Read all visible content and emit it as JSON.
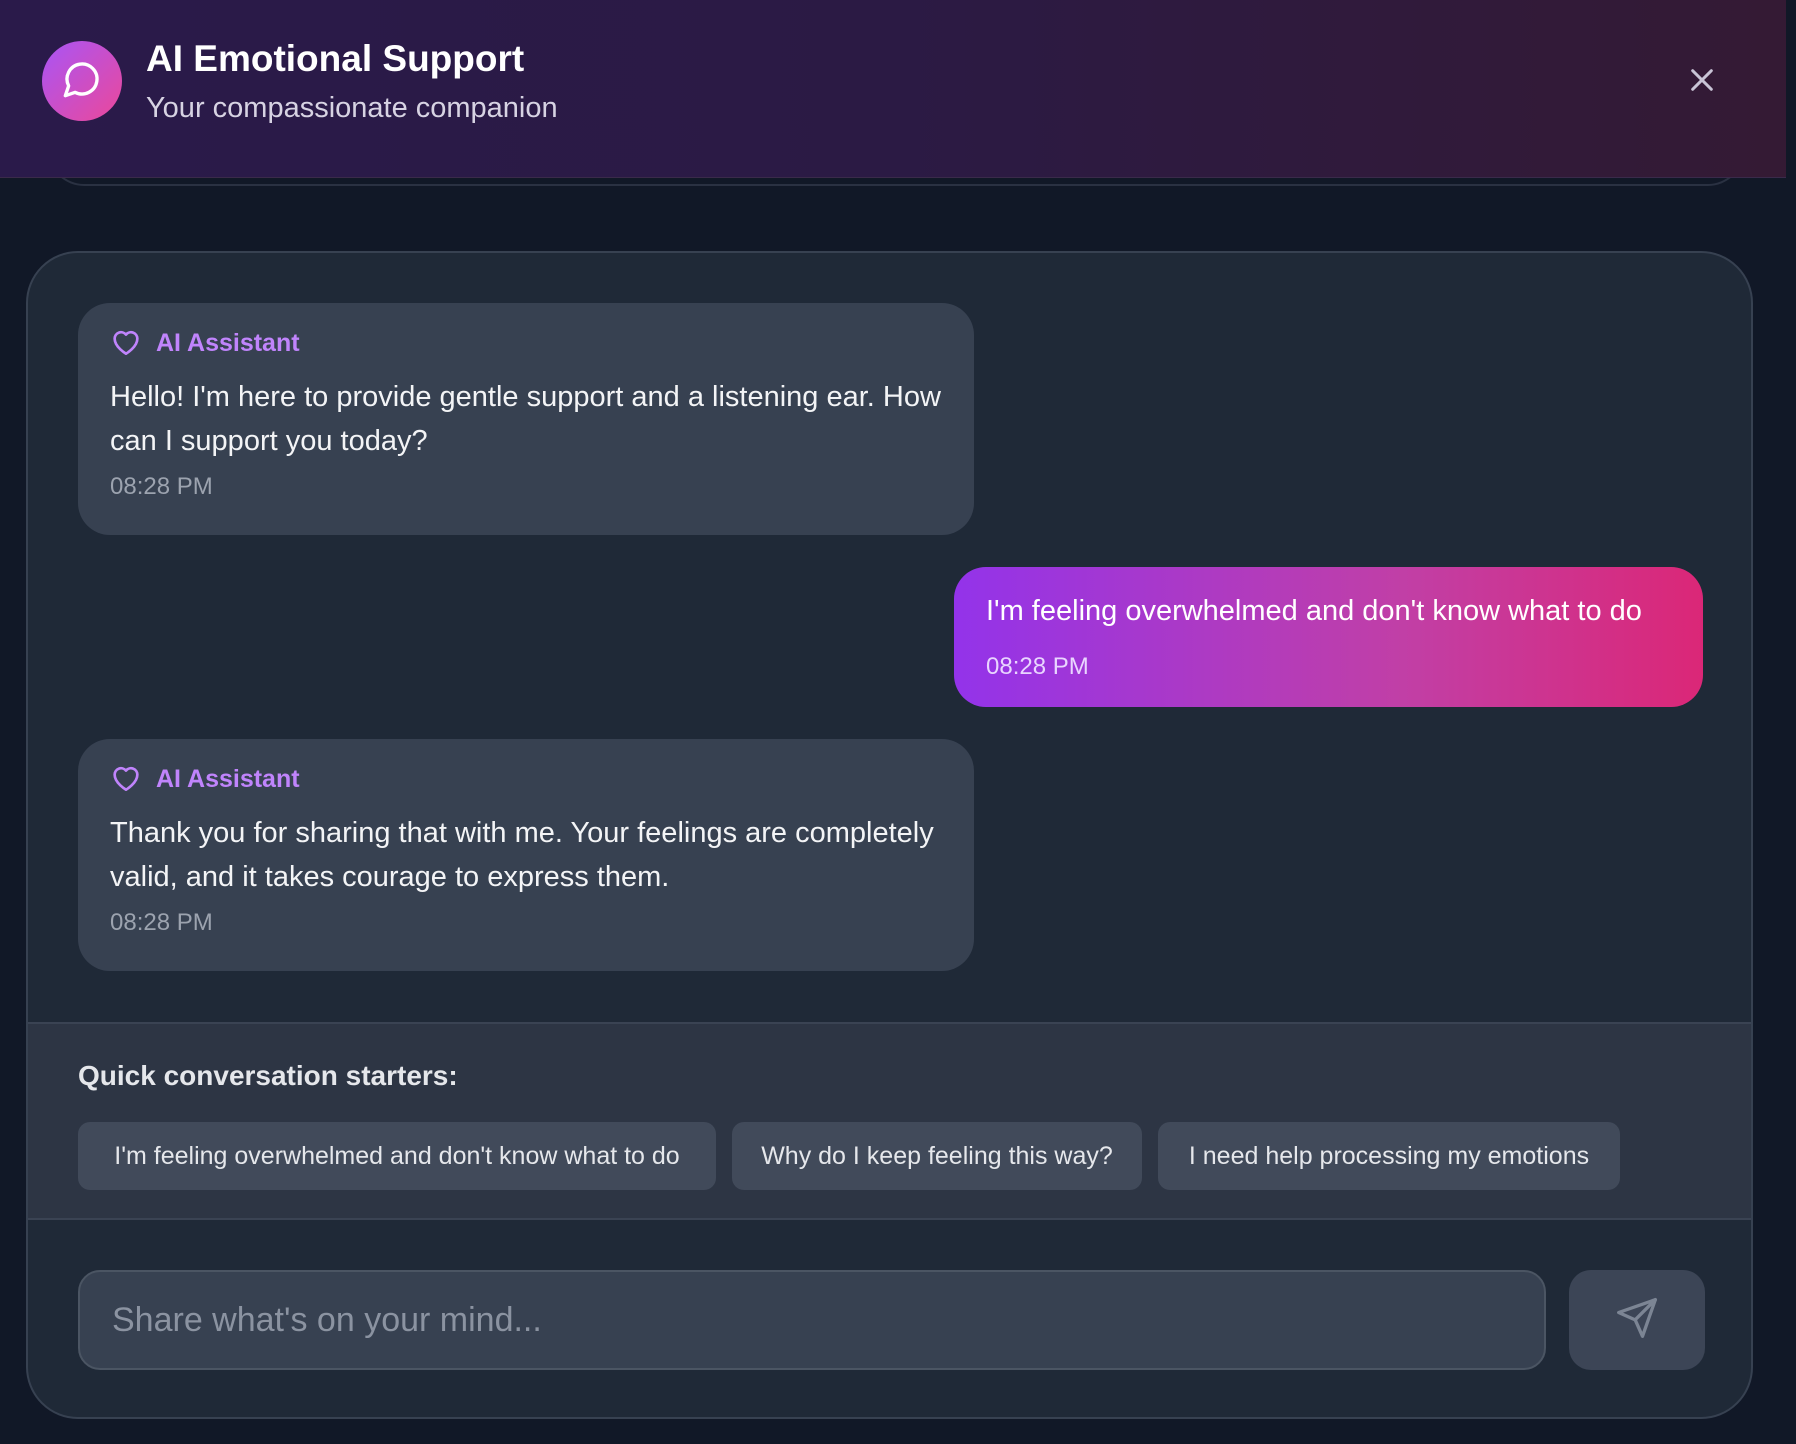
{
  "header": {
    "title": "AI Emotional Support",
    "subtitle": "Your compassionate companion",
    "avatar_icon": "chat-bubble-icon",
    "close_icon": "close-icon"
  },
  "messages": [
    {
      "role": "assistant",
      "sender": "AI Assistant",
      "icon": "heart-icon",
      "text": "Hello! I'm here to provide gentle support and a listening ear. How can I support you today?",
      "time": "08:28 PM"
    },
    {
      "role": "user",
      "text": "I'm feeling overwhelmed and don't know what to do",
      "time": "08:28 PM"
    },
    {
      "role": "assistant",
      "sender": "AI Assistant",
      "icon": "heart-icon",
      "text": "Thank you for sharing that with me. Your feelings are completely valid, and it takes courage to express them.",
      "time": "08:28 PM"
    }
  ],
  "starters": {
    "label": "Quick conversation starters:",
    "items": [
      "I'm feeling overwhelmed and don't know what to do",
      "Why do I keep feeling this way?",
      "I need help processing my emotions"
    ]
  },
  "composer": {
    "placeholder": "Share what's on your mind...",
    "value": "",
    "send_icon": "send-icon"
  },
  "colors": {
    "accent_purple": "#9333ea",
    "accent_pink": "#db2777",
    "assistant_label": "#c084fc",
    "panel_bg": "#1f2937",
    "bubble_bg": "#374151"
  }
}
